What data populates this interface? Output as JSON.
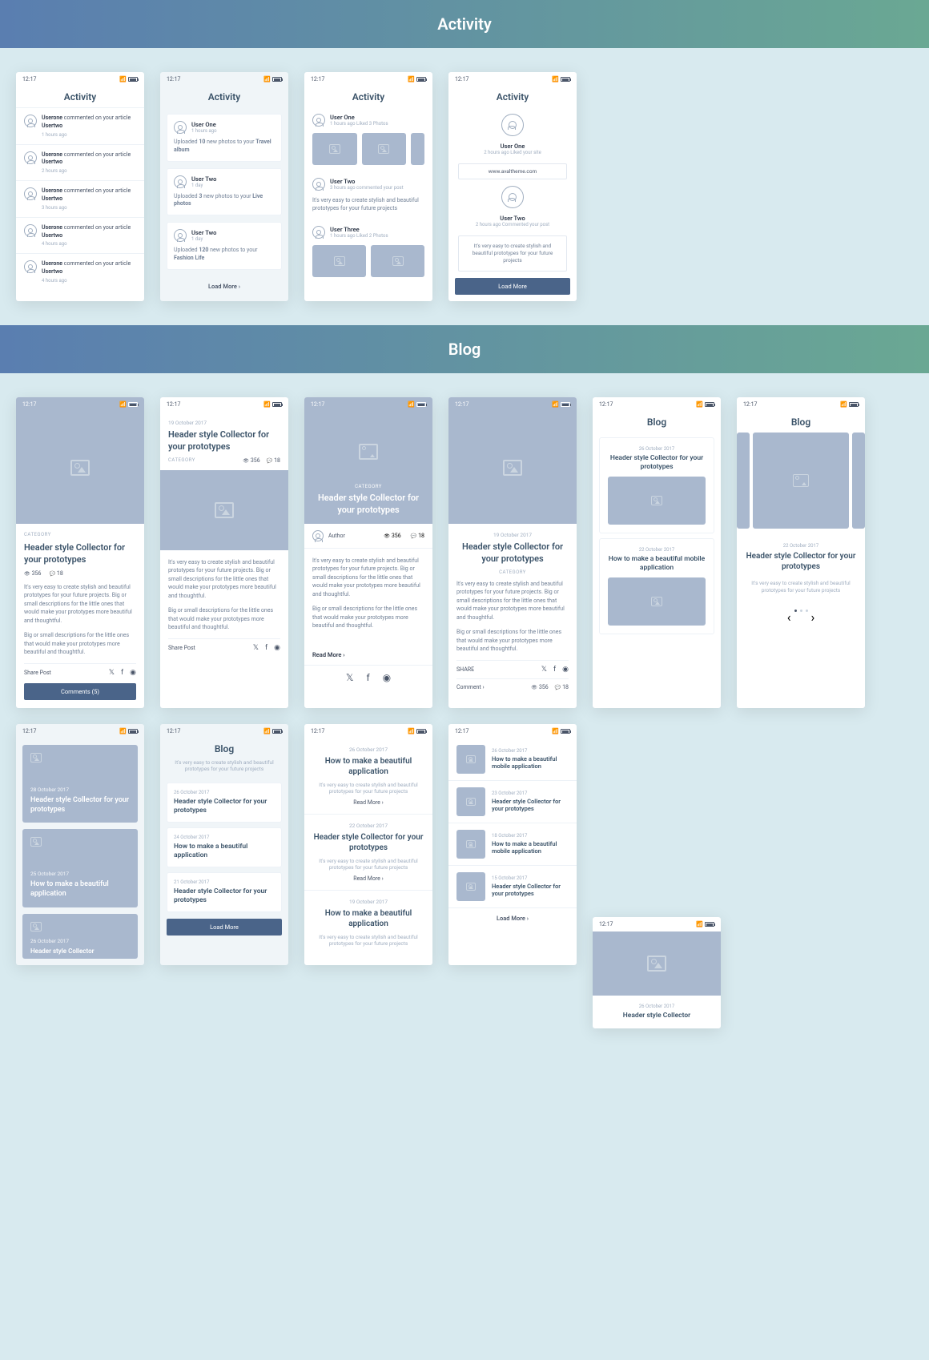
{
  "sections": {
    "activity": "Activity",
    "blog": "Blog"
  },
  "statusTime": "12:17",
  "activity": {
    "title": "Activity",
    "s1_items": [
      {
        "user": "Userone",
        "action": "commented on your article",
        "target": "Usertwo",
        "time": "1 hours ago"
      },
      {
        "user": "Userone",
        "action": "commented on your article",
        "target": "Usertwo",
        "time": "2 hours ago"
      },
      {
        "user": "Userone",
        "action": "commented on your article",
        "target": "Usertwo",
        "time": "3 hours ago"
      },
      {
        "user": "Userone",
        "action": "commented on your article",
        "target": "Usertwo",
        "time": "4 hours ago"
      },
      {
        "user": "Userone",
        "action": "commented on your article",
        "target": "Usertwo",
        "time": "4 hours ago"
      }
    ],
    "s2_items": [
      {
        "user": "User One",
        "time": "1 hours ago",
        "pre": "Uploaded",
        "count": "10",
        "mid": "new photos to your",
        "album": "Travel album"
      },
      {
        "user": "User Two",
        "time": "1 day",
        "pre": "Uploaded",
        "count": "3",
        "mid": "new photos to your",
        "album": "Live photos"
      },
      {
        "user": "User Two",
        "time": "1 day",
        "pre": "Uploaded",
        "count": "120",
        "mid": "new photos to your",
        "album": "Fashion Life"
      }
    ],
    "loadMore": "Load More",
    "s3": {
      "u1": {
        "name": "User One",
        "meta": "1 hours ago Liked 3 Photos"
      },
      "u2": {
        "name": "User Two",
        "meta": "3 hours ago commented your post"
      },
      "quote": "It's very easy to create stylish and beautiful prototypes for your future projects",
      "u3": {
        "name": "User Three",
        "meta": "1 hours ago Liked 2 Photos"
      }
    },
    "s4": {
      "u1": {
        "name": "User One",
        "meta": "2 hours ago    Liked your site"
      },
      "link": "www.avaltheme.com",
      "u2": {
        "name": "User Two",
        "meta": "2 hours ago    Commented your post"
      },
      "quote": "It's very easy to create stylish and beautiful prototypes for your future projects"
    }
  },
  "blog": {
    "title": "Blog",
    "category": "CATEGORY",
    "views": "356",
    "comments": "18",
    "author": "Author",
    "headerTitle": "Header style Collector for your prototypes",
    "howTo": "How to make a beautiful application",
    "howToMobile": "How to make a beautiful mobile application",
    "para1": "It's very easy to create stylish and beautiful prototypes for your future projects. Big or small descriptions for the little ones that would make your prototypes more beautiful and thoughtful.",
    "para2": "Big or small descriptions for the little ones that would make your prototypes more beautiful and thoughtful.",
    "sub": "It's very easy to create stylish and beautiful prototypes for your future projects",
    "sharePost": "Share Post",
    "share": "SHARE",
    "commentsBtn": "Comments (5)",
    "readMore": "Read More",
    "comment": "Comment",
    "dates": {
      "d19": "19 October 2017",
      "d26": "26 October 2017",
      "d22": "22 October 2017",
      "d24": "24 October 2017",
      "d21": "21 October 2017",
      "d28": "28 October 2017",
      "d25": "25 October 2017",
      "d23": "23 October 2017",
      "d18": "18 October 2017",
      "d15": "15 October 2017"
    }
  }
}
